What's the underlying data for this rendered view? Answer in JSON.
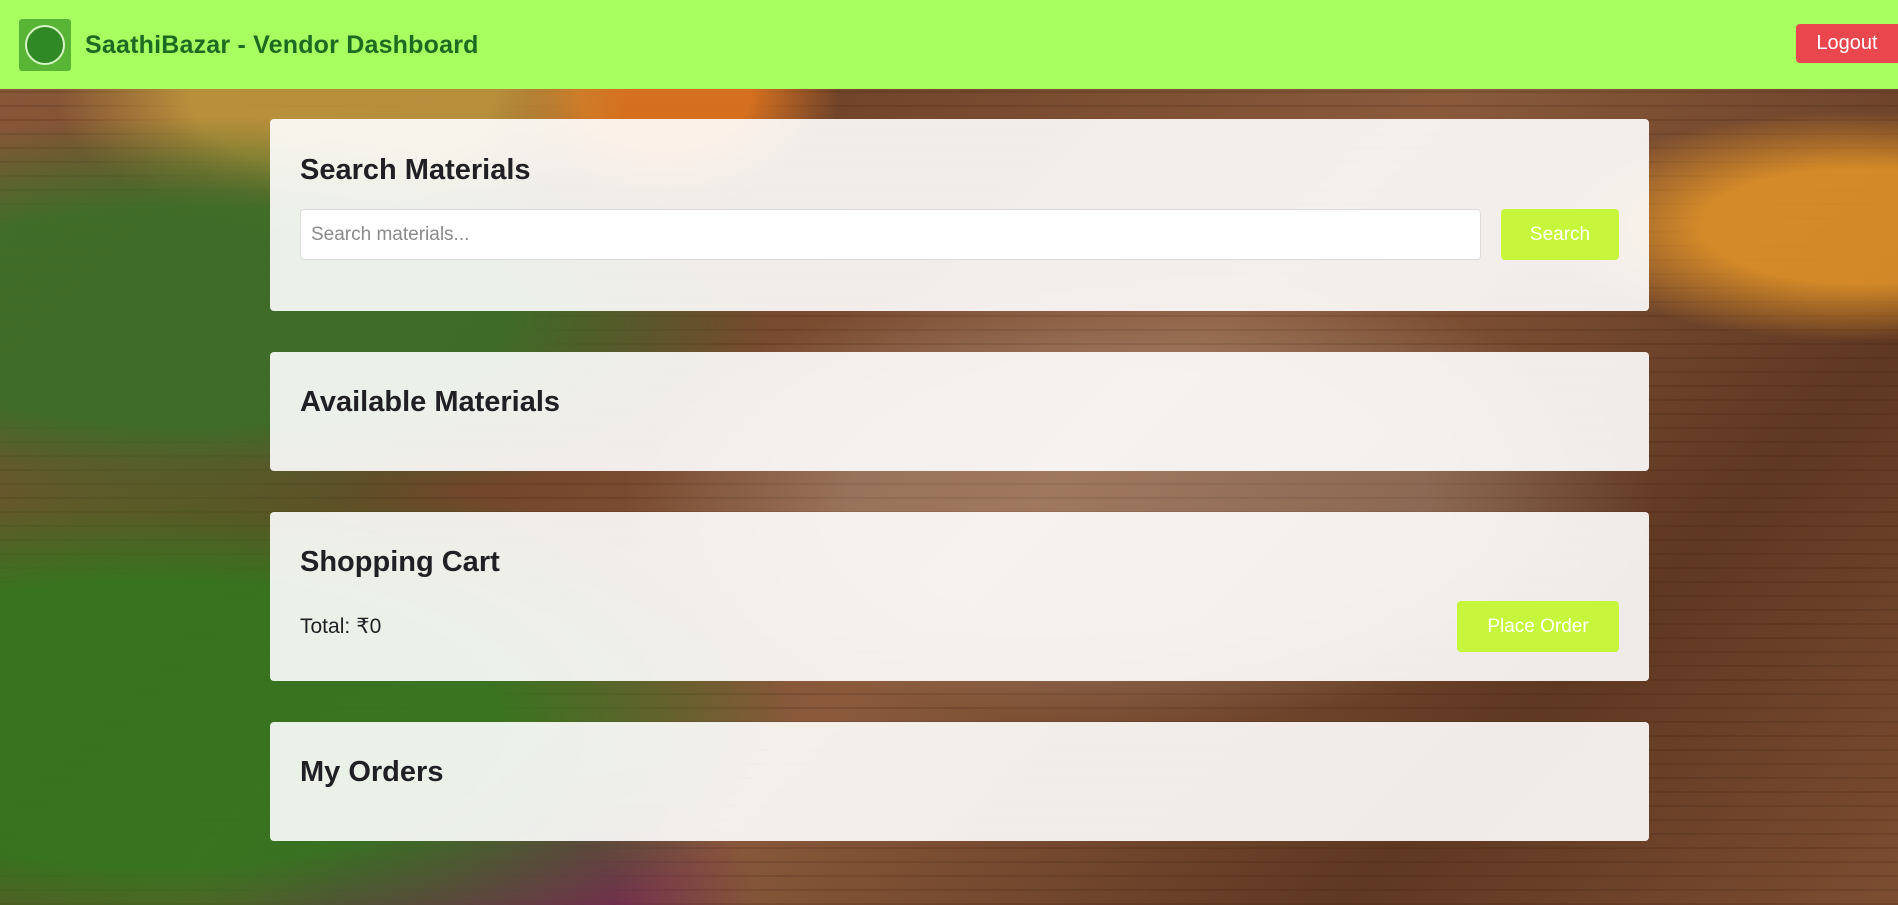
{
  "header": {
    "title": "SaathiBazar - Vendor Dashboard",
    "logo_icon": "saathibazar-logo",
    "logout_label": "Logout"
  },
  "search": {
    "heading": "Search Materials",
    "placeholder": "Search materials...",
    "value": "",
    "button_label": "Search"
  },
  "available": {
    "heading": "Available Materials"
  },
  "cart": {
    "heading": "Shopping Cart",
    "total_label": "Total:",
    "total_value": "₹0",
    "place_order_label": "Place Order"
  },
  "orders": {
    "heading": "My Orders"
  },
  "colors": {
    "header_bg": "#a8ff60",
    "header_text": "#1c6b22",
    "logout_bg": "#e9464e",
    "action_button_bg": "#c6f53c"
  }
}
